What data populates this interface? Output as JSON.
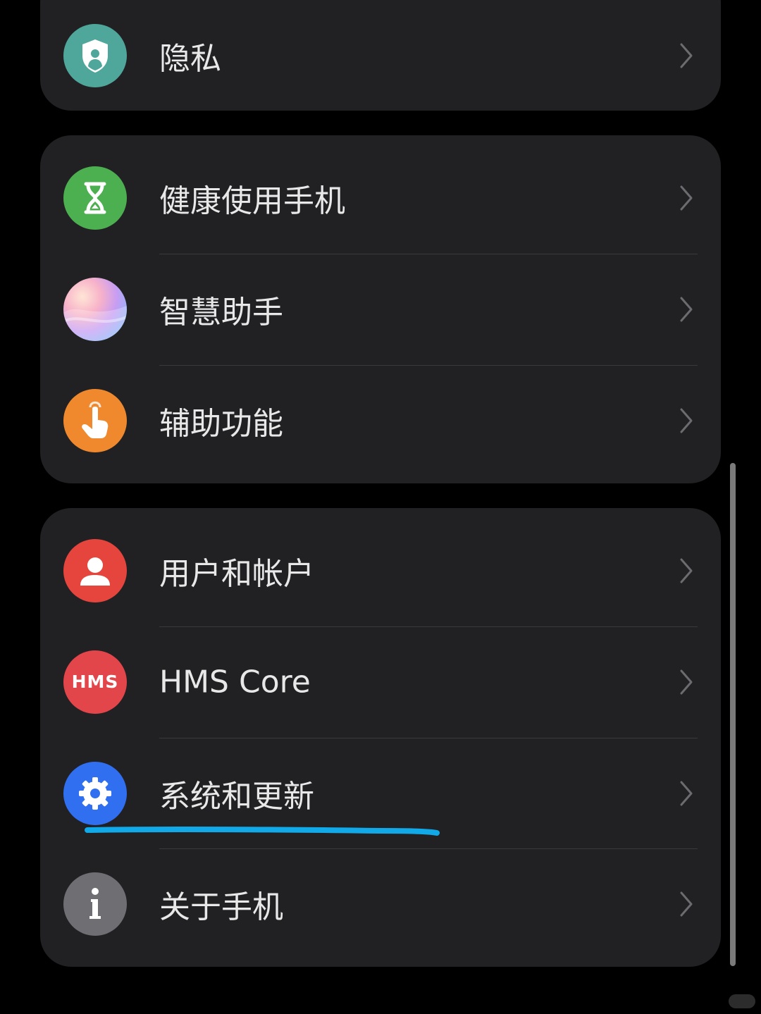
{
  "groups": [
    {
      "items": [
        {
          "label": "隐私",
          "icon": "privacy-shield-icon",
          "color": "#4fa69a"
        }
      ]
    },
    {
      "items": [
        {
          "label": "健康使用手机",
          "icon": "hourglass-icon",
          "color": "#4caf50"
        },
        {
          "label": "智慧助手",
          "icon": "assistant-orb-icon",
          "color": "#c9a6f5"
        },
        {
          "label": "辅助功能",
          "icon": "touch-hand-icon",
          "color": "#f0892e"
        }
      ]
    },
    {
      "items": [
        {
          "label": "用户和帐户",
          "icon": "user-icon",
          "color": "#e5453c"
        },
        {
          "label": "HMS Core",
          "icon": "hms-icon",
          "color": "#e2454a",
          "badge": "HMS"
        },
        {
          "label": "系统和更新",
          "icon": "gear-icon",
          "color": "#2f6ff0"
        },
        {
          "label": "关于手机",
          "icon": "info-icon",
          "color": "#6f6f73"
        }
      ]
    }
  ],
  "colors": {
    "background": "#000000",
    "card": "#212124",
    "text": "#e8e8e8",
    "chevron": "#6c6c70",
    "annotation_underline": "#12a9e8"
  }
}
